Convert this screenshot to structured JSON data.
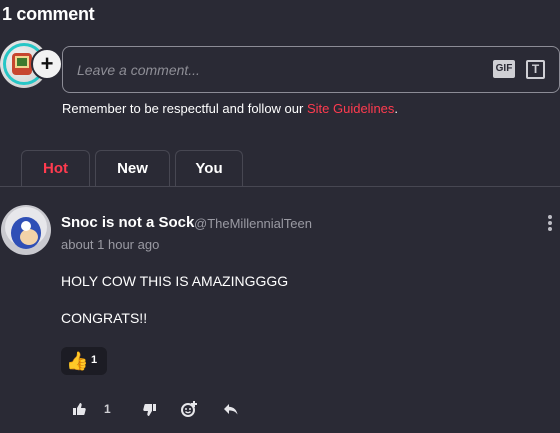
{
  "header": {
    "comment_count_title": "1 comment"
  },
  "composer": {
    "add_symbol": "+",
    "placeholder": "Leave a comment...",
    "gif_label": "GIF",
    "text_icon_label": "T"
  },
  "guidelines": {
    "prefix": "Remember to be respectful and follow our ",
    "link": "Site Guidelines",
    "suffix": "."
  },
  "tabs": [
    {
      "label": "Hot",
      "active": true
    },
    {
      "label": "New",
      "active": false
    },
    {
      "label": "You",
      "active": false
    }
  ],
  "comment": {
    "author": "Snoc is not a Sock",
    "handle": "@TheMillennialTeen",
    "time": "about 1 hour ago",
    "lines": [
      "HOLY COW THIS IS AMAZINGGGG",
      "CONGRATS!!"
    ],
    "reaction": {
      "emoji": "👍",
      "count": "1"
    },
    "like_count": "1"
  },
  "colors": {
    "accent": "#ff3b4f",
    "background": "#2a2a35",
    "border": "#474752"
  },
  "icons": {
    "like": "thumbs-up-icon",
    "dislike": "thumbs-down-icon",
    "react": "add-reaction-icon",
    "reply": "reply-icon",
    "menu": "more-vertical-icon"
  }
}
